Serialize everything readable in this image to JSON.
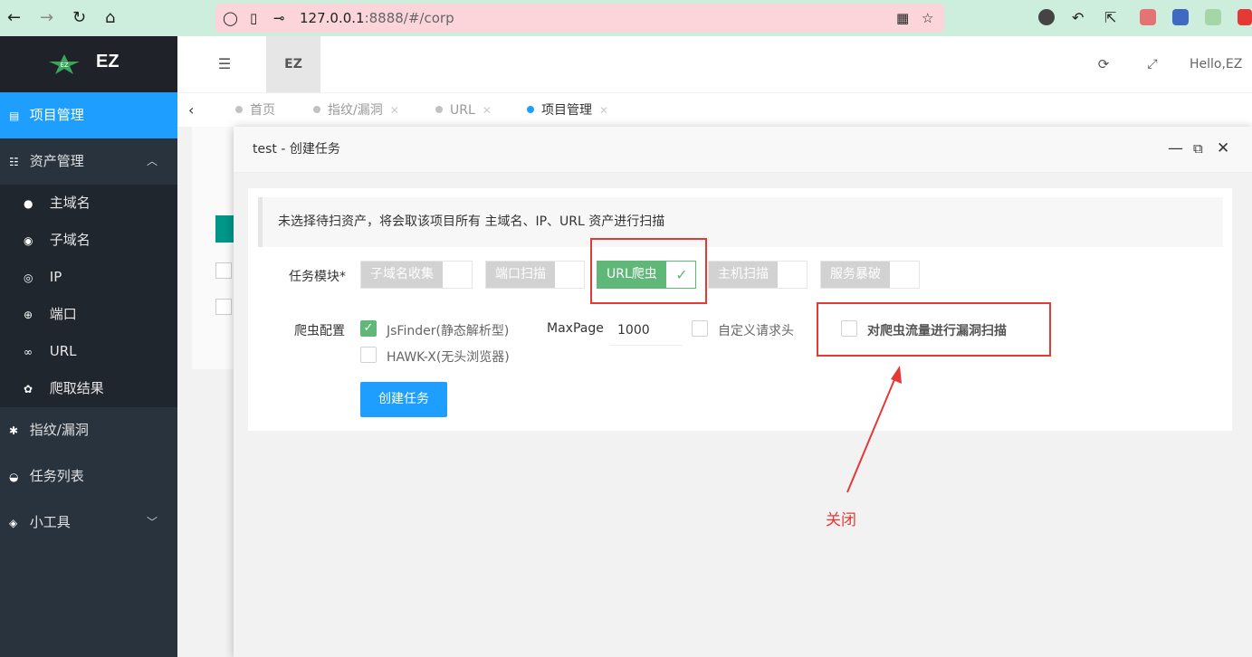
{
  "browser": {
    "url_host": "127.0.0.1",
    "url_rest": ":8888/#/corp"
  },
  "sidebar": {
    "brand": "EZ",
    "items": [
      {
        "label": "项目管理",
        "icon": "list-icon"
      },
      {
        "label": "资产管理",
        "icon": "table-icon"
      }
    ],
    "sub_items": [
      {
        "label": "主域名",
        "icon": "domain-icon"
      },
      {
        "label": "子域名",
        "icon": "globe-icon"
      },
      {
        "label": "IP",
        "icon": "location-icon"
      },
      {
        "label": "端口",
        "icon": "port-icon"
      },
      {
        "label": "URL",
        "icon": "link-icon"
      },
      {
        "label": "爬取结果",
        "icon": "paw-icon"
      }
    ],
    "bottom_items": [
      {
        "label": "指纹/漏洞",
        "icon": "bug-icon"
      },
      {
        "label": "任务列表",
        "icon": "dashboard-icon"
      },
      {
        "label": "小工具",
        "icon": "cube-icon"
      }
    ]
  },
  "header": {
    "tab_label": "EZ",
    "greeting": "Hello,EZ"
  },
  "tabs": [
    {
      "label": "首页"
    },
    {
      "label": "指纹/漏洞"
    },
    {
      "label": "URL"
    },
    {
      "label": "项目管理"
    }
  ],
  "modal": {
    "title": "test - 创建任务",
    "notice": "未选择待扫资产，将会取该项目所有 主域名、IP、URL 资产进行扫描",
    "task_module_label": "任务模块*",
    "modules": [
      {
        "label": "子域名收集",
        "on": false
      },
      {
        "label": "端口扫描",
        "on": false
      },
      {
        "label": "URL爬虫",
        "on": true
      },
      {
        "label": "主机扫描",
        "on": false
      },
      {
        "label": "服务暴破",
        "on": false
      }
    ],
    "crawler_label": "爬虫配置",
    "jsfinder": "JsFinder(静态解析型)",
    "hawk": "HAWK-X(无头浏览器)",
    "maxpage_label": "MaxPage",
    "maxpage_value": "1000",
    "custom_header": "自定义请求头",
    "vuln_scan": "对爬虫流量进行漏洞扫描",
    "create_button": "创建任务"
  },
  "annotation": {
    "text": "关闭",
    "color": "#e53935"
  }
}
